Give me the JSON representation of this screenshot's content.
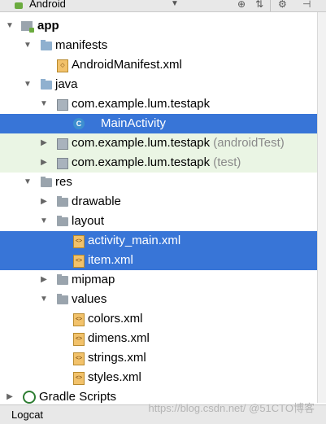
{
  "toolbar": {
    "title": "Android",
    "dropdown_glyph": "▼",
    "icons": [
      "globe-icon",
      "collapse-icon",
      "gear-icon",
      "hide-icon"
    ]
  },
  "tree": {
    "rows": [
      {
        "label": "app"
      },
      {
        "label": "manifests"
      },
      {
        "label": "AndroidManifest.xml"
      },
      {
        "label": "java"
      },
      {
        "label": "com.example.lum.testapk"
      },
      {
        "label": "MainActivity"
      },
      {
        "label": "com.example.lum.testapk",
        "suffix": "(androidTest)"
      },
      {
        "label": "com.example.lum.testapk",
        "suffix": "(test)"
      },
      {
        "label": "res"
      },
      {
        "label": "drawable"
      },
      {
        "label": "layout"
      },
      {
        "label": "activity_main.xml"
      },
      {
        "label": "item.xml"
      },
      {
        "label": "mipmap"
      },
      {
        "label": "values"
      },
      {
        "label": "colors.xml"
      },
      {
        "label": "dimens.xml"
      },
      {
        "label": "strings.xml"
      },
      {
        "label": "styles.xml"
      },
      {
        "label": "Gradle Scripts"
      }
    ]
  },
  "bottom": {
    "tab": "Logcat",
    "watermark": "https://blog.csdn.net/ @51CTO博客"
  },
  "colors": {
    "selection": "#3875d7",
    "test_highlight": "#eaf5e4"
  }
}
